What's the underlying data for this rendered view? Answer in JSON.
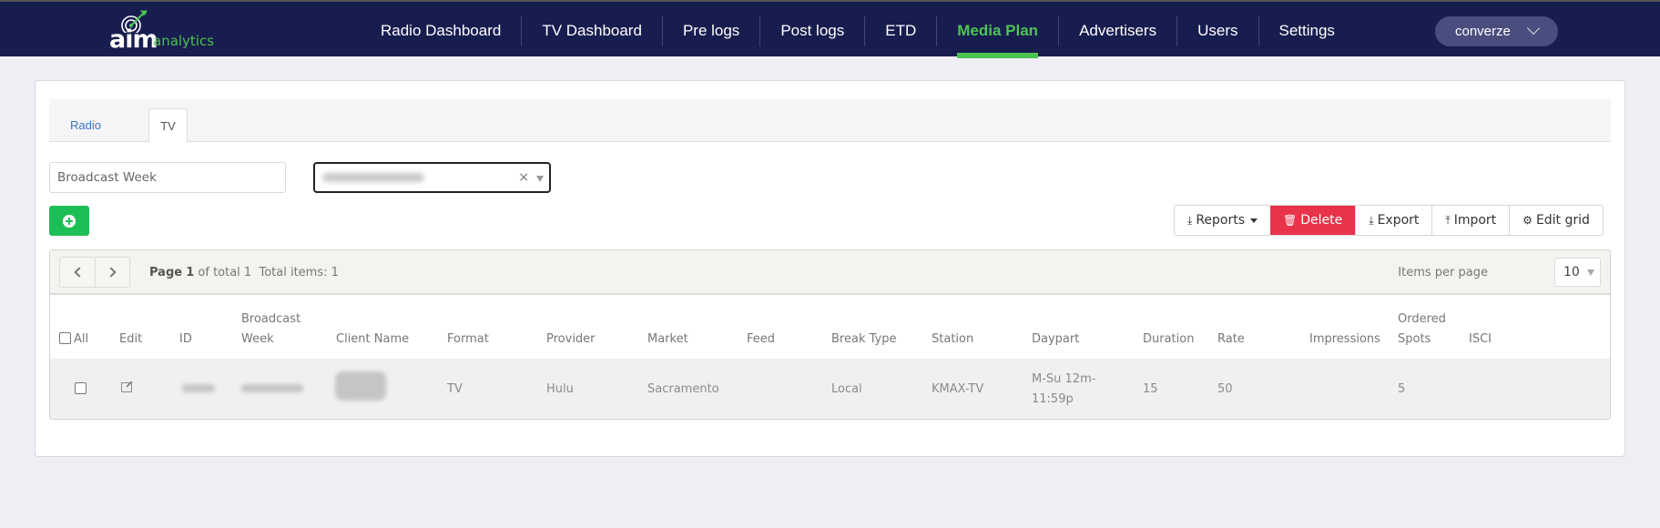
{
  "header": {
    "logo": {
      "brand": "aim",
      "suffix": "analytics"
    },
    "nav": [
      {
        "label": "Radio Dashboard",
        "active": false
      },
      {
        "label": "TV Dashboard",
        "active": false
      },
      {
        "label": "Pre logs",
        "active": false
      },
      {
        "label": "Post logs",
        "active": false
      },
      {
        "label": "ETD",
        "active": false
      },
      {
        "label": "Media Plan",
        "active": true
      },
      {
        "label": "Advertisers",
        "active": false
      },
      {
        "label": "Users",
        "active": false
      },
      {
        "label": "Settings",
        "active": false
      }
    ],
    "user": {
      "name": "converze",
      "icon": "chevron-down-icon"
    },
    "colors": {
      "navbar": "#181d4f",
      "accent": "#4cc452"
    }
  },
  "tabs": [
    {
      "label": "Radio",
      "active": false
    },
    {
      "label": "TV",
      "active": true
    }
  ],
  "filters": {
    "broadcast_week": {
      "placeholder": "Broadcast Week",
      "value": ""
    },
    "client_select": {
      "value": "[redacted]",
      "clear_glyph": "×"
    }
  },
  "toolbar": {
    "add_icon": "plus-circle-icon",
    "buttons": [
      {
        "label": "Reports",
        "icon": "download-icon",
        "dropdown": true
      },
      {
        "label": "Delete",
        "icon": "trash-icon",
        "color": "#e8334a"
      },
      {
        "label": "Export",
        "icon": "download-icon"
      },
      {
        "label": "Import",
        "icon": "upload-icon"
      },
      {
        "label": "Edit grid",
        "icon": "gears-icon"
      }
    ]
  },
  "pager": {
    "page_word": "Page",
    "page": "1",
    "of_total": "of total 1",
    "total_items": "Total items: 1",
    "items_per_page_label": "Items per page",
    "items_per_page": "10"
  },
  "table": {
    "columns": [
      {
        "key": "select",
        "label": "All"
      },
      {
        "key": "edit",
        "label": "Edit"
      },
      {
        "key": "id",
        "label": "ID"
      },
      {
        "key": "week",
        "label": "Broadcast Week"
      },
      {
        "key": "client",
        "label": "Client Name"
      },
      {
        "key": "format",
        "label": "Format"
      },
      {
        "key": "provider",
        "label": "Provider"
      },
      {
        "key": "market",
        "label": "Market"
      },
      {
        "key": "feed",
        "label": "Feed"
      },
      {
        "key": "break_type",
        "label": "Break Type"
      },
      {
        "key": "station",
        "label": "Station"
      },
      {
        "key": "daypart",
        "label": "Daypart"
      },
      {
        "key": "duration",
        "label": "Duration"
      },
      {
        "key": "rate",
        "label": "Rate"
      },
      {
        "key": "impressions",
        "label": "Impressions"
      },
      {
        "key": "ordered_spots",
        "label": "Ordered Spots"
      },
      {
        "key": "isci",
        "label": "ISCI"
      }
    ],
    "rows": [
      {
        "id": "[redacted]",
        "week": "[redacted]",
        "client": "[redacted]",
        "format": "TV",
        "provider": "Hulu",
        "market": "Sacramento",
        "feed": "",
        "break_type": "Local",
        "station": "KMAX-TV",
        "daypart": "M-Su 12m-11:59p",
        "duration": "15",
        "rate": "50",
        "impressions": "",
        "ordered_spots": "5",
        "isci": ""
      }
    ]
  }
}
